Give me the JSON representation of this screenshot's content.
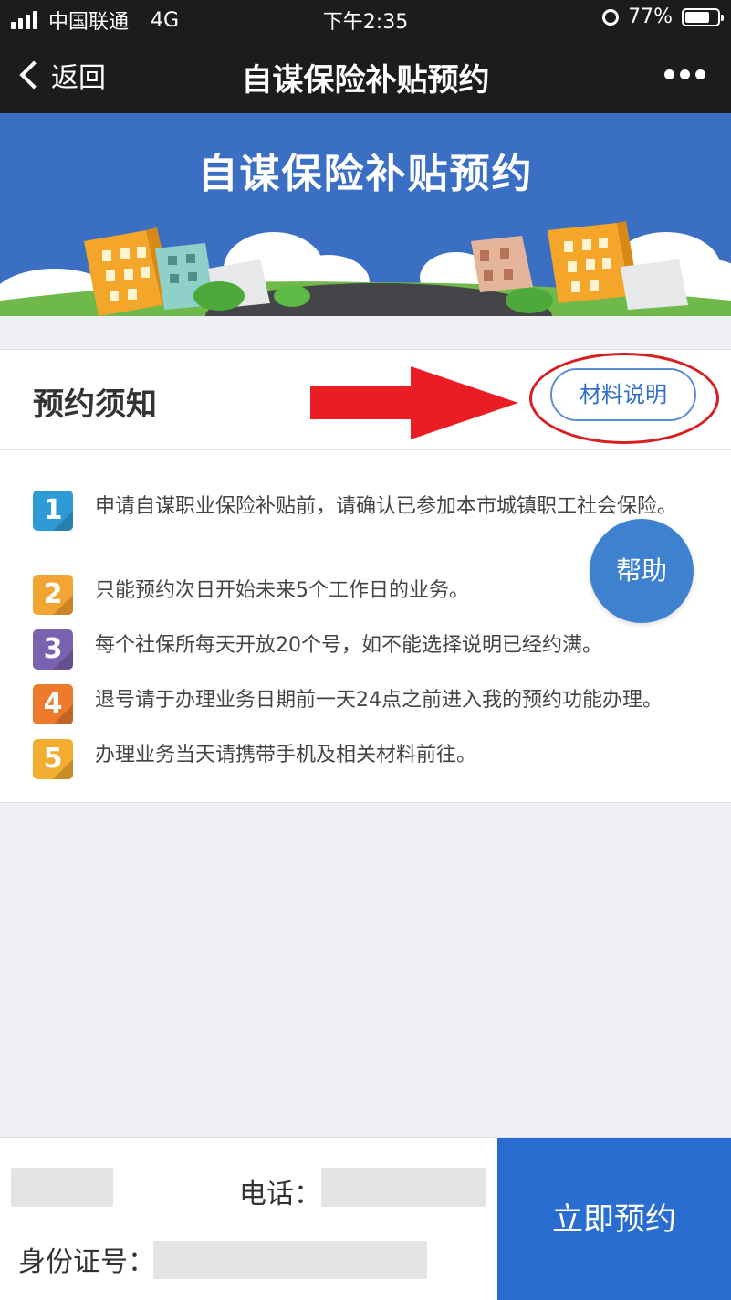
{
  "status_bar": {
    "carrier": "中国联通",
    "network": "4G",
    "time": "下午2:35",
    "battery": "77%",
    "alarm_icon": "alarm-clock-icon"
  },
  "nav": {
    "back_label": "返回",
    "title": "自谋保险补贴预约",
    "more_icon": "more-dots-icon"
  },
  "banner": {
    "title": "自谋保险补贴预约"
  },
  "notice": {
    "heading": "预约须知",
    "materials_button": "材料说明",
    "items": [
      {
        "num": "1",
        "color": "#2e9bd6",
        "text": "申请自谋职业保险补贴前，请确认已参加本市城镇职工社会保险。"
      },
      {
        "num": "2",
        "color": "#f3a533",
        "text": "只能预约次日开始未来5个工作日的业务。"
      },
      {
        "num": "3",
        "color": "#7a62b0",
        "text": "每个社保所每天开放20个号，如不能选择说明已经约满。"
      },
      {
        "num": "4",
        "color": "#ee7a2c",
        "text": "退号请于办理业务日期前一天24点之前进入我的预约功能办理。"
      },
      {
        "num": "5",
        "color": "#f2ac2f",
        "text": "办理业务当天请携带手机及相关材料前往。"
      }
    ]
  },
  "help_button": "帮助",
  "footer": {
    "phone_label": "电话：",
    "id_label": "身份证号：",
    "reserve_button": "立即预约"
  },
  "colors": {
    "nav_bg": "#1c1c1e",
    "banner_bg": "#3b6fc4",
    "accent": "#2a6dd0",
    "annotation_red": "#d81e1e"
  }
}
